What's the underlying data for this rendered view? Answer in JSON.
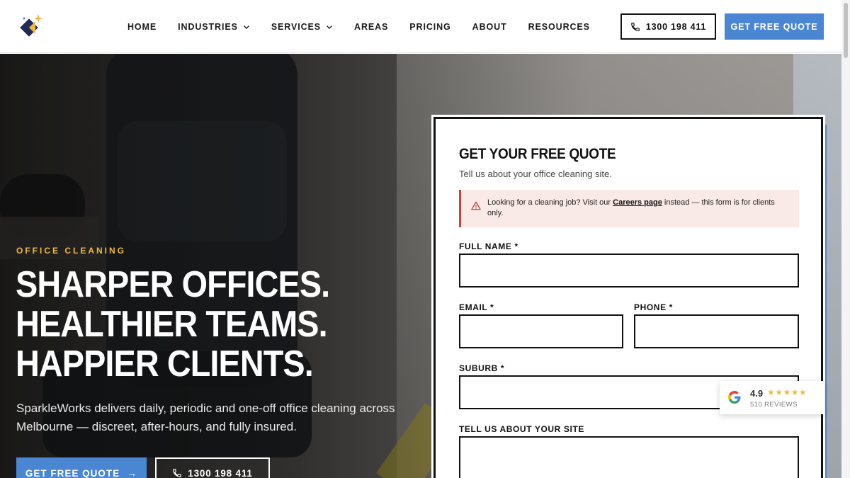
{
  "header": {
    "nav": [
      {
        "label": "HOME",
        "dropdown": false
      },
      {
        "label": "INDUSTRIES",
        "dropdown": true
      },
      {
        "label": "SERVICES",
        "dropdown": true
      },
      {
        "label": "AREAS",
        "dropdown": false
      },
      {
        "label": "PRICING",
        "dropdown": false
      },
      {
        "label": "ABOUT",
        "dropdown": false
      },
      {
        "label": "RESOURCES",
        "dropdown": false
      }
    ],
    "phone_label": "1300 198 411",
    "quote_label": "GET FREE QUOTE"
  },
  "hero": {
    "eyebrow": "OFFICE CLEANING",
    "headline": [
      "SHARPER OFFICES.",
      "HEALTHIER TEAMS.",
      "HAPPIER CLIENTS."
    ],
    "subcopy": "SparkleWorks delivers daily, periodic and one-off office cleaning across Melbourne — discreet, after-hours, and fully insured.",
    "primary_cta": "GET FREE QUOTE",
    "secondary_cta": "1300 198 411"
  },
  "form": {
    "title": "GET YOUR FREE QUOTE",
    "subtitle": "Tell us about your office cleaning site.",
    "alert": {
      "before_link": "Looking for a cleaning job? Visit our ",
      "link": "Careers page",
      "after_link": " instead — this form is for clients only."
    },
    "fields": {
      "full_name": {
        "label": "FULL NAME *",
        "value": "",
        "placeholder": ""
      },
      "email": {
        "label": "EMAIL *",
        "value": "",
        "placeholder": ""
      },
      "phone": {
        "label": "PHONE *",
        "value": "",
        "placeholder": ""
      },
      "suburb": {
        "label": "SUBURB *",
        "value": "",
        "placeholder": ""
      },
      "site": {
        "label": "TELL US ABOUT YOUR SITE",
        "value": "",
        "placeholder": ""
      }
    }
  },
  "reviews": {
    "rating": "4.9",
    "stars": "★★★★★",
    "count": "510 REVIEWS"
  },
  "colors": {
    "accent": "#4a86d1",
    "eyebrow": "#f2b83b",
    "alert_bg": "#f9e9e7",
    "alert_border": "#c24536"
  }
}
